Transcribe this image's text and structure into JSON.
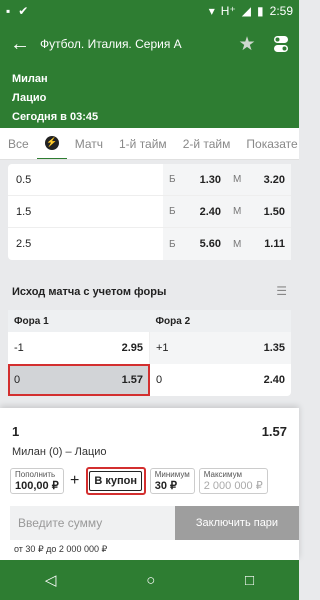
{
  "status_bar": {
    "time": "2:59",
    "network": "H⁺"
  },
  "header": {
    "title": "Футбол. Италия. Серия А"
  },
  "match": {
    "team1": "Милан",
    "team2": "Лацио",
    "start": "Сегодня в 03:45"
  },
  "tabs": [
    "Все",
    "Матч",
    "1-й тайм",
    "2-й тайм",
    "Показате"
  ],
  "totals": [
    {
      "param": "0.5",
      "b_label": "Б",
      "b": "1.30",
      "m_label": "М",
      "m": "3.20"
    },
    {
      "param": "1.5",
      "b_label": "Б",
      "b": "2.40",
      "m_label": "М",
      "m": "1.50"
    },
    {
      "param": "2.5",
      "b_label": "Б",
      "b": "5.60",
      "m_label": "М",
      "m": "1.11"
    }
  ],
  "handicap": {
    "title": "Исход матча с учетом форы",
    "col1": "Фора 1",
    "col2": "Фора 2",
    "rows": [
      {
        "h1": "-1",
        "o1": "2.95",
        "h2": "+1",
        "o2": "1.35"
      },
      {
        "h1": "0",
        "o1": "1.57",
        "h2": "0",
        "o2": "2.40"
      }
    ]
  },
  "coupon": {
    "count": "1",
    "odd": "1.57",
    "event": "Милан (0) – Лацио",
    "topup_small": "Пополнить",
    "topup_big": "100,00 ₽",
    "plus": "+",
    "add_button": "В купон",
    "min_small": "Минимум",
    "min_big": "30 ₽",
    "max_small": "Максимум",
    "max_big": "2 000 000 ₽",
    "amount_placeholder": "Введите сумму",
    "submit": "Заключить пари",
    "range": "от 30 ₽ до 2 000 000 ₽"
  }
}
